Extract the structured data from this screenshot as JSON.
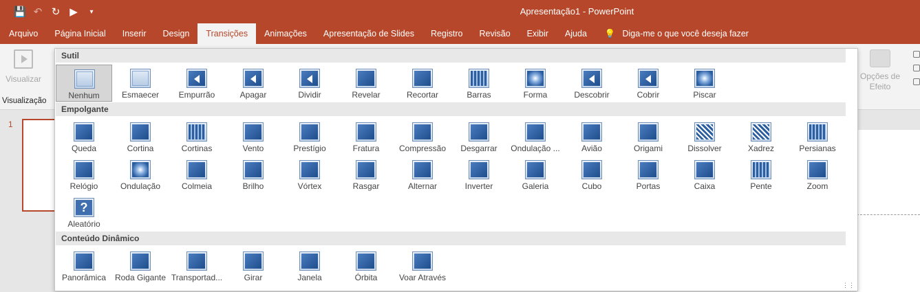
{
  "window": {
    "title": "Apresentação1  -  PowerPoint"
  },
  "qat": [
    {
      "icon": "save-icon"
    },
    {
      "icon": "undo-icon"
    },
    {
      "icon": "redo-icon"
    },
    {
      "icon": "present-from-start-icon"
    },
    {
      "icon": "customize-qat-icon"
    }
  ],
  "tabs": [
    "Arquivo",
    "Página Inicial",
    "Inserir",
    "Design",
    "Transições",
    "Animações",
    "Apresentação de Slides",
    "Registro",
    "Revisão",
    "Exibir",
    "Ajuda"
  ],
  "active_tab": "Transições",
  "tell_me": "Diga-me o que você deseja fazer",
  "ribbon": {
    "preview_label": "Visualizar",
    "preview_group": "Visualização",
    "effect_options": "Opções de Efeito"
  },
  "slide_number": "1",
  "gallery": {
    "sections": [
      {
        "title": "Sutil",
        "items": [
          "Nenhum",
          "Esmaecer",
          "Empurrão",
          "Apagar",
          "Dividir",
          "Revelar",
          "Recortar",
          "Barras",
          "Forma",
          "Descobrir",
          "Cobrir",
          "Piscar"
        ]
      },
      {
        "title": "Empolgante",
        "items": [
          "Queda",
          "Cortina",
          "Cortinas",
          "Vento",
          "Prestígio",
          "Fratura",
          "Compressão",
          "Desgarrar",
          "Ondulação ...",
          "Avião",
          "Origami",
          "Dissolver",
          "Xadrez",
          "Persianas",
          "Relógio",
          "Ondulação",
          "Colmeia",
          "Brilho",
          "Vórtex",
          "Rasgar",
          "Alternar",
          "Inverter",
          "Galeria",
          "Cubo",
          "Portas",
          "Caixa",
          "Pente",
          "Zoom",
          "Aleatório"
        ]
      },
      {
        "title": "Conteúdo Dinâmico",
        "items": [
          "Panorâmica",
          "Roda Gigante",
          "Transportad...",
          "Girar",
          "Janela",
          "Órbita",
          "Voar Através"
        ]
      }
    ],
    "selected": "Nenhum"
  }
}
